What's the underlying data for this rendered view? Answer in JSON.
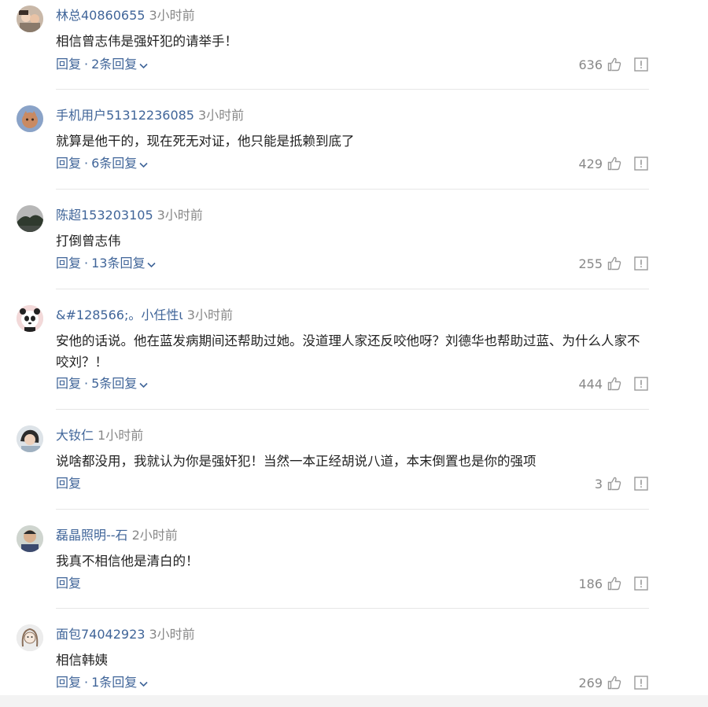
{
  "labels": {
    "reply": "回复",
    "dot": "·"
  },
  "colors": {
    "username": "#406599",
    "time": "#888888",
    "text": "#222222",
    "divider": "#e6e6e6"
  },
  "comments": [
    {
      "user": "林总40860655",
      "time": "3小时前",
      "text": "相信曾志伟是强奸犯的请举手！",
      "replies": "2条回复",
      "likes": "636",
      "avatar_icon": "avatar-photo-two-kids"
    },
    {
      "user": "手机用户51312236085",
      "time": "3小时前",
      "text": "就算是他干的，现在死无对证，他只能是抵赖到底了",
      "replies": "6条回复",
      "likes": "429",
      "avatar_icon": "avatar-default-cartoon"
    },
    {
      "user": "陈超153203105",
      "time": "3小时前",
      "text": "打倒曾志伟",
      "replies": "13条回复",
      "likes": "255",
      "avatar_icon": "avatar-landscape"
    },
    {
      "user": "&#128566;。小任性ι",
      "time": "3小时前",
      "text": "安他的话说。他在蓝发病期间还帮助过她。没道理人家还反咬他呀？刘德华也帮助过蓝、为什么人家不咬刘？！",
      "replies": "5条回复",
      "likes": "444",
      "avatar_icon": "avatar-panda"
    },
    {
      "user": "大钕仁",
      "time": "1小时前",
      "text": "说啥都没用，我就认为你是强奸犯！当然一本正经胡说八道，本末倒置也是你的强项",
      "replies": "",
      "likes": "3",
      "avatar_icon": "avatar-woman-portrait"
    },
    {
      "user": "磊晶照明--石",
      "time": "2小时前",
      "text": "我真不相信他是清白的！",
      "replies": "",
      "likes": "186",
      "avatar_icon": "avatar-man-portrait"
    },
    {
      "user": "面包74042923",
      "time": "3小时前",
      "text": "相信韩姨",
      "replies": "1条回复",
      "likes": "269",
      "avatar_icon": "avatar-sketch"
    }
  ]
}
